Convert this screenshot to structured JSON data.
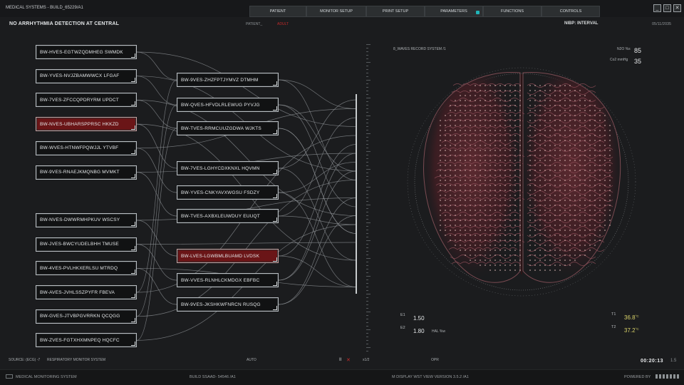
{
  "app": {
    "title": "MEDICAL SYSTEMS - BUILD_65229/A1",
    "menu": [
      {
        "label": "PATIENT"
      },
      {
        "label": "MONITOR SETUP"
      },
      {
        "label": "PRINT SETUP"
      },
      {
        "label": "PARAMETERS"
      },
      {
        "label": "FUNCTIONS"
      },
      {
        "label": "CONTROLS"
      }
    ],
    "window_buttons": [
      "_",
      "□",
      "✕"
    ]
  },
  "header": {
    "alarm": "NO ARRHYTHMIA DETECTION AT CENTRAL",
    "patient_label": "PATIENT_",
    "patient_value": "ADULT",
    "nibp": "NIBP: INTERVAL",
    "date": "05/11/2035"
  },
  "nodes_left": [
    "BW-HVES-EGTWZQDMHEG SWMDK",
    "BW-YVES-NVJZBAMWWCX LFGAF",
    "BW-7VES-ZFCCQPDRYRM UPDCT",
    "BW-NVES-UBHARSPPRSC HKKZD",
    "BW-WVES-HTNWFPQWJJL YTVBF",
    "BW-9VES-RNAEJKMQNBG MVMKT",
    "BW-NVES-DWWRMHPKUV WSCSY",
    "BW-JVES-BWCYUDELBHH TMUSE",
    "BW-4VES-PVLHKXERLSU MTRDQ",
    "BW-AVES-JVHLSSZPYFR FBEVA",
    "BW-GVES-JTVBPGVRRKN QCQGG",
    "BW-ZVES-FGTXHXMNPEQ HQCFC"
  ],
  "nodes_mid": [
    "BW-9VES-ZHZFPTJYMVZ DTMHM",
    "BW-QVES-HFVDLRLEWUG PYVJG",
    "BW-TVES-RRMCUUZGDWA WJKTS",
    "BW-7VES-LGHYCDXKNXL HQVMN",
    "BW-YVES-CNKYAVXWGSU FSDZY",
    "BW-TVES-AXBXLEUWDUY EUUQT",
    "BW-LVES-LGWBMLBUAMD LVDSK",
    "BW-VVES-RLNHLCKMDGX EBFBC",
    "BW-9VES-JKSHKWFNRCN RUSQG"
  ],
  "selected": {
    "left_index": 3,
    "mid_index": 6
  },
  "record": {
    "label": "8_WAVES RECORD SYSTEM /1",
    "n2o_label": "N2O %s",
    "n2o_value": "85",
    "co2_label": "Co2 mmHg",
    "co2_value": "35"
  },
  "vitals": {
    "e1_label": "E1",
    "e1_value": "1.50",
    "e2_label": "E2",
    "e2_value": "1.80",
    "hal_label": "HAL %w",
    "t1_label": "T1",
    "t1_value": "36.8",
    "t2_label": "T2",
    "t2_value": "37.2",
    "temp_unit": "°C"
  },
  "status": {
    "source": "SOURCE: (ECG) -7",
    "system": "RESPIRATORY MONITOR SYSTEM",
    "mode": "AUTO",
    "pause": "II",
    "stop": "✕",
    "speed": "x1/2",
    "opr": "OPR",
    "timer": "00:20:13",
    "timer_sub": "1.5"
  },
  "footer": {
    "system": "MEDICAL MONITORING SYSTEM",
    "build": "BUILD SSAAD- 54546 /A1",
    "version": "M DISPLAY WST VIEW  VERSION 3.5.2 /A1",
    "powered": "POWERED BY"
  },
  "colors": {
    "accent": "#20b4b8",
    "alert": "#c22a2a",
    "selected_node": "#6a1517",
    "temp": "#d9d36a"
  }
}
